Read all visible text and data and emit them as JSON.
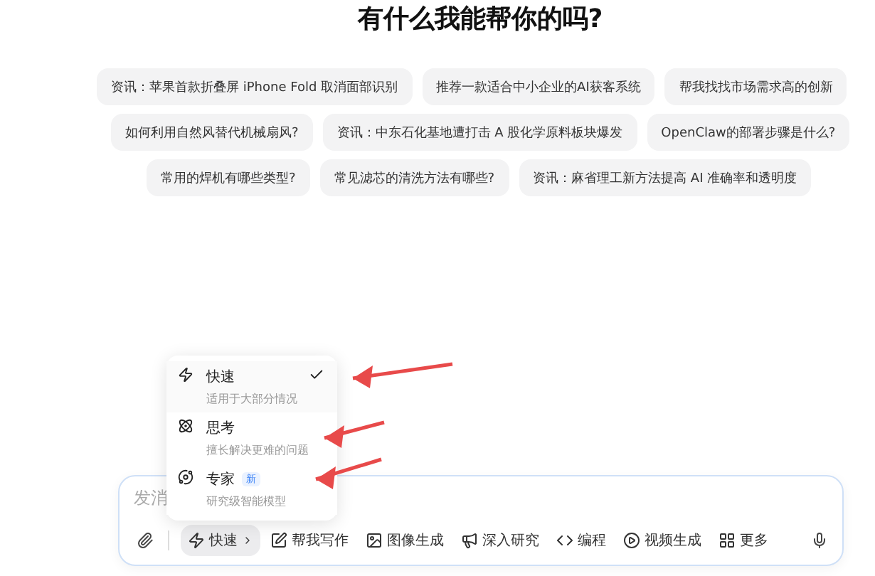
{
  "heading": "有什么我能帮你的吗?",
  "suggestion_rows": [
    {
      "chips": [
        "资讯：苹果首款折叠屏 iPhone Fold 取消面部识别",
        "推荐一款适合中小企业的AI获客系统",
        "帮我找找市场需求高的创新"
      ]
    },
    {
      "chips": [
        "如何利用自然风替代机械扇风?",
        "资讯：中东石化基地遭打击 A 股化学原料板块爆发",
        "OpenClaw的部署步骤是什么?"
      ]
    },
    {
      "chips": [
        "常用的焊机有哪些类型?",
        "常见滤芯的清洗方法有哪些?",
        "资讯：麻省理工新方法提高 AI 准确率和透明度"
      ]
    }
  ],
  "mode_menu": {
    "items": [
      {
        "kind": "fast",
        "title": "快速",
        "subtitle": "适用于大部分情况",
        "selected": true
      },
      {
        "kind": "think",
        "title": "思考",
        "subtitle": "擅长解决更难的问题",
        "selected": false
      },
      {
        "kind": "expert",
        "title": "专家",
        "badge": "新",
        "subtitle": "研究级智能模型",
        "selected": false
      }
    ]
  },
  "composer": {
    "placeholder": "发消",
    "tools": [
      {
        "kind": "mode",
        "label": "快速",
        "selected": true
      },
      {
        "kind": "write",
        "label": "帮我写作",
        "selected": false
      },
      {
        "kind": "image",
        "label": "图像生成",
        "selected": false
      },
      {
        "kind": "research",
        "label": "深入研究",
        "selected": false
      },
      {
        "kind": "code",
        "label": "编程",
        "selected": false
      },
      {
        "kind": "video",
        "label": "视频生成",
        "selected": false
      },
      {
        "kind": "more",
        "label": "更多",
        "selected": false
      }
    ]
  }
}
